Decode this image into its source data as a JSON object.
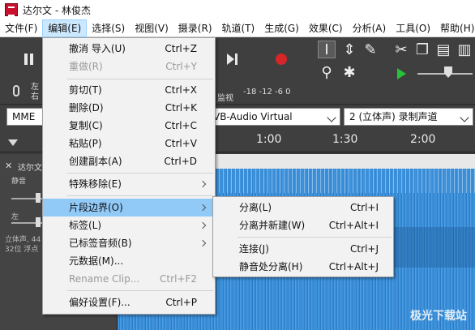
{
  "window": {
    "title": "达尔文 - 林俊杰"
  },
  "menubar": {
    "items": [
      "文件(F)",
      "编辑(E)",
      "选择(S)",
      "视图(V)",
      "摄录(R)",
      "轨道(T)",
      "生成(G)",
      "效果(C)",
      "分析(A)",
      "工具(O)",
      "帮助(H)"
    ]
  },
  "toolbar": {
    "meter_lr_top": "左",
    "meter_lr_bottom": "右",
    "meter_scale": "-18  -12  -6  0",
    "monitor_label": "监视"
  },
  "devices": {
    "host": "MME",
    "output": "VB-Audio Virtual",
    "channels": "2 (立体声) 录制声道"
  },
  "ruler": {
    "ticks": [
      "1:00",
      "1:30",
      "2:00"
    ]
  },
  "track": {
    "name": "达尔文",
    "gain_label": "静音",
    "pan_label": "左",
    "info": "立体声, 44\n32位 浮点"
  },
  "edit_menu": {
    "items": [
      {
        "label": "撤消 导入(U)",
        "shortcut": "Ctrl+Z",
        "disabled": false
      },
      {
        "label": "重做(R)",
        "shortcut": "Ctrl+Y",
        "disabled": true
      },
      {
        "label": "剪切(T)",
        "shortcut": "Ctrl+X",
        "disabled": false
      },
      {
        "label": "删除(D)",
        "shortcut": "Ctrl+K",
        "disabled": false
      },
      {
        "label": "复制(C)",
        "shortcut": "Ctrl+C",
        "disabled": false
      },
      {
        "label": "粘贴(P)",
        "shortcut": "Ctrl+V",
        "disabled": false
      },
      {
        "label": "创建副本(A)",
        "shortcut": "Ctrl+D",
        "disabled": false
      },
      {
        "label": "特殊移除(E)",
        "shortcut": "",
        "submenu": true
      },
      {
        "label": "片段边界(O)",
        "shortcut": "",
        "submenu": true,
        "highlighted": true
      },
      {
        "label": "标签(L)",
        "shortcut": "",
        "submenu": true
      },
      {
        "label": "已标签音频(B)",
        "shortcut": "",
        "submenu": true
      },
      {
        "label": "元数据(M)...",
        "shortcut": ""
      },
      {
        "label": "Rename Clip...",
        "shortcut": "Ctrl+F2",
        "disabled": true
      },
      {
        "label": "偏好设置(F)...",
        "shortcut": "Ctrl+P",
        "disabled": false
      }
    ]
  },
  "clip_boundaries_submenu": {
    "items": [
      {
        "label": "分离(L)",
        "shortcut": "Ctrl+I"
      },
      {
        "label": "分离并新建(W)",
        "shortcut": "Ctrl+Alt+I"
      },
      {
        "label": "连接(J)",
        "shortcut": "Ctrl+J"
      },
      {
        "label": "静音处分离(H)",
        "shortcut": "Ctrl+Alt+J"
      }
    ]
  },
  "watermark": "极光下载站"
}
